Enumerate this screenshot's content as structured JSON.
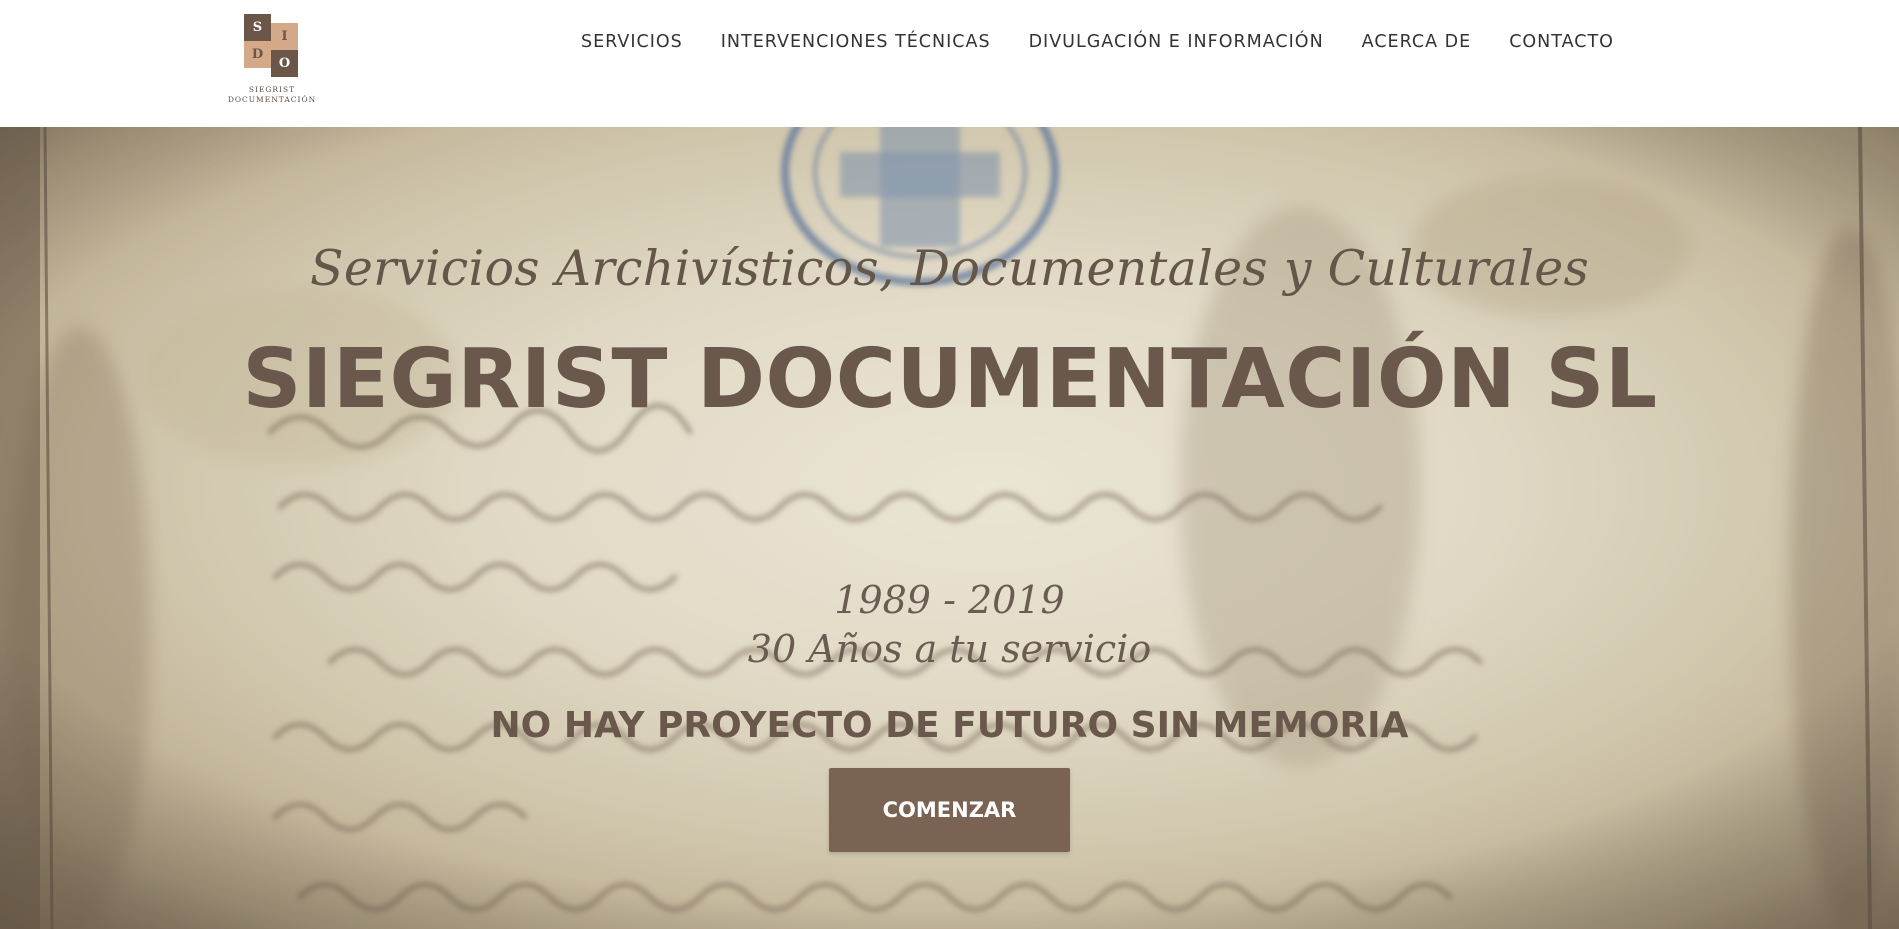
{
  "header": {
    "logo": {
      "letters": [
        "S",
        "I",
        "D",
        "O"
      ],
      "text_line1": "SIEGRIST",
      "text_line2": "DOCUMENTACIÓN",
      "colors": {
        "light": "#d4a98a",
        "dark": "#6b5648",
        "text": "#ffffff"
      }
    },
    "nav": [
      {
        "label": "SERVICIOS"
      },
      {
        "label": "INTERVENCIONES TÉCNICAS"
      },
      {
        "label": "DIVULGACIÓN E INFORMACIÓN"
      },
      {
        "label": "ACERCA DE"
      },
      {
        "label": "CONTACTO"
      }
    ]
  },
  "hero": {
    "tagline": "Servicios Archivísticos, Documentales y Culturales",
    "title": "SIEGRIST DOCUMENTACIÓN SL",
    "years": "1989 - 2019",
    "years_subtitle": "30 Años a tu servicio",
    "motto": "NO HAY PROYECTO DE FUTURO SIN MEMORIA",
    "cta_label": "COMENZAR",
    "background_image": "aged-manuscript-with-blue-seal",
    "colors": {
      "heading": "#6a584c",
      "button": "#7b6353",
      "button_text": "#ffffff"
    }
  }
}
